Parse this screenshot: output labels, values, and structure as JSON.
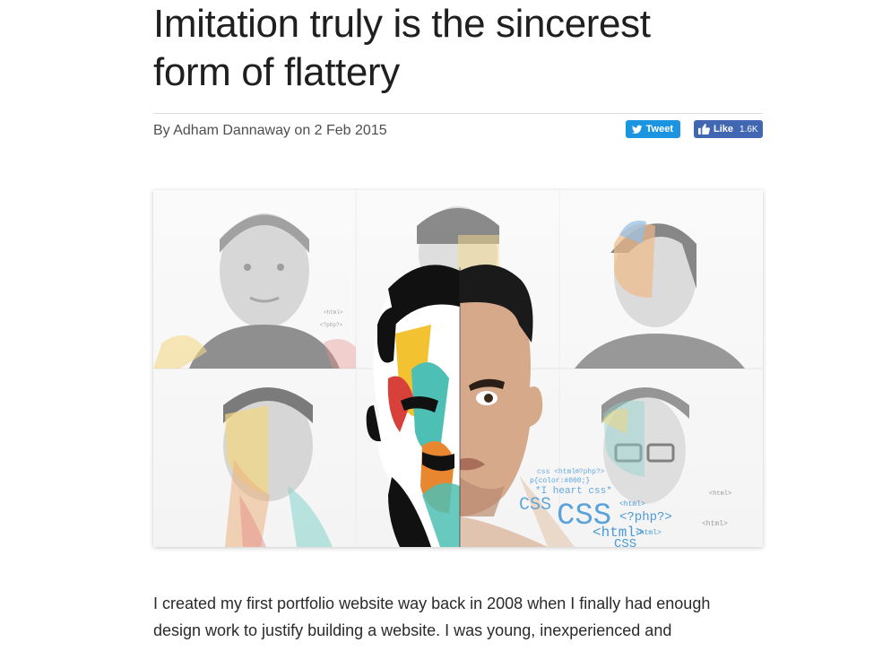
{
  "article": {
    "title_line1": "Imitation truly is the sincerest",
    "title_line2": "form of flattery",
    "byline": "By Adham Dannaway on 2 Feb 2015",
    "share": {
      "tweet_label": "Tweet",
      "like_label": "Like",
      "like_count": "1.6K"
    },
    "hero_image": {
      "alt": "Collage of portraits half-painted in colorful brush strokes",
      "code_snippets": [
        "css <html>",
        "<?php?>",
        "p{color:#000;}",
        "*I heart css*",
        "CSS",
        "CSS",
        "<html>",
        "<?php?>",
        "<html>",
        "<html>",
        "CSS"
      ],
      "colors": {
        "accent_yellow": "#f2c230",
        "accent_teal": "#4dbfb4",
        "accent_orange": "#e8872f",
        "accent_red": "#d8413a",
        "accent_blue": "#3b8fd6",
        "code_blue": "#4a9ad6"
      }
    },
    "paragraph_line1": "I created my first portfolio website way back in 2008 when I finally had enough",
    "paragraph_line2": "design work to justify building a website. I was young, inexperienced and"
  },
  "colors": {
    "tweet_bg": "#1b95e0",
    "like_bg": "#4267b2",
    "text": "#222222",
    "divider": "#dcdcdc"
  }
}
